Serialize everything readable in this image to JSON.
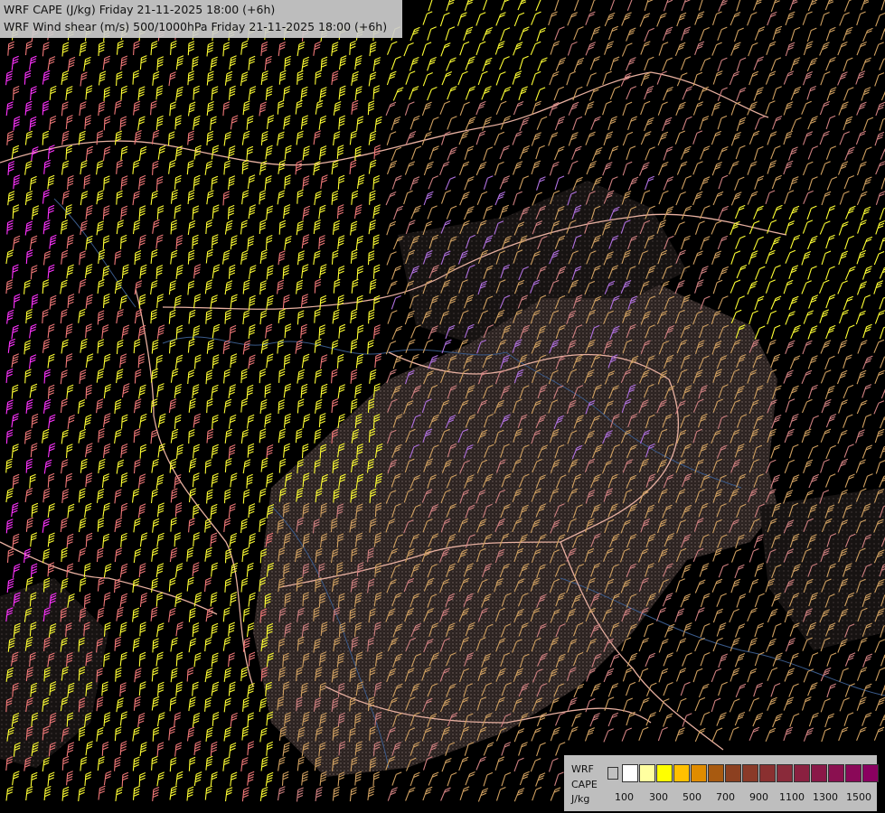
{
  "title": {
    "line1": "WRF CAPE (J/kg) Friday 21-11-2025 18:00 (+6h)",
    "line2": "WRF Wind shear (m/s) 500/1000hPa Friday 21-11-2025 18:00 (+6h)"
  },
  "legend": {
    "label1": "WRF",
    "label2": "CAPE",
    "label3": "J/kg",
    "ticks": [
      "100",
      "300",
      "500",
      "700",
      "900",
      "1100",
      "1300",
      "1500"
    ],
    "colors": [
      "#c0c0c0",
      "#ffffff",
      "#ffffa0",
      "#ffff00",
      "#ffc000",
      "#e08c00",
      "#a85a10",
      "#8c4020",
      "#8a3a28",
      "#8a3030",
      "#8a2a3a",
      "#8a2040",
      "#8a1848",
      "#8a1050",
      "#8a0858",
      "#8a0060"
    ]
  },
  "barb_colors": {
    "yellow": "#ffff33",
    "salmon": "#f07878",
    "magenta": "#ff33ff",
    "tan": "#d0a060",
    "pink": "#d08080",
    "violet": "#b070e0"
  }
}
